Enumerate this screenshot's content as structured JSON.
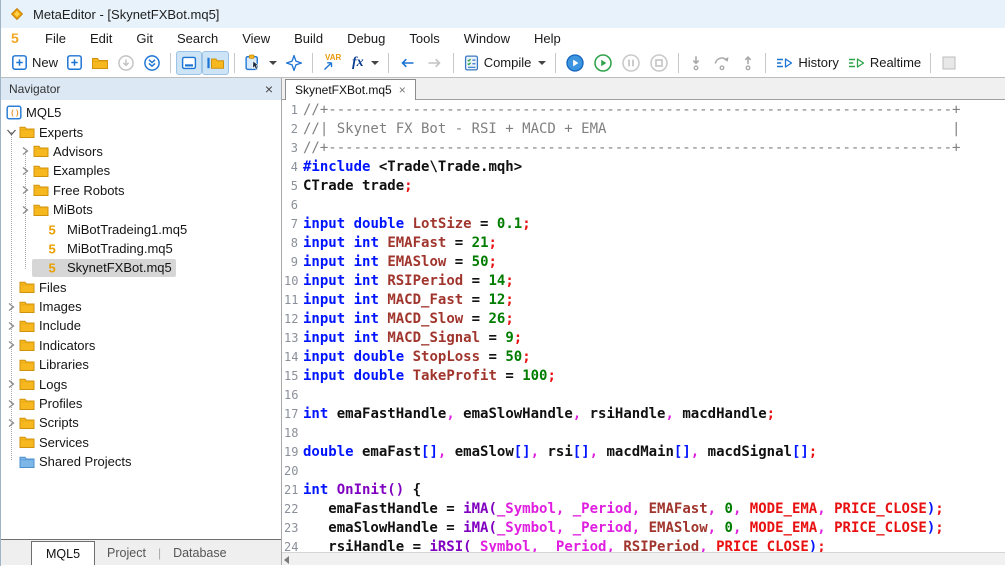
{
  "window": {
    "title": "MetaEditor - [SkynetFXBot.mq5]"
  },
  "menu": {
    "logo": "5",
    "items": [
      "File",
      "Edit",
      "Git",
      "Search",
      "View",
      "Build",
      "Debug",
      "Tools",
      "Window",
      "Help"
    ]
  },
  "toolbar": {
    "new": "New",
    "compile": "Compile",
    "history": "History",
    "realtime": "Realtime",
    "var_glyph": "VAR",
    "fx_glyph": "fx"
  },
  "navigator": {
    "title": "Navigator",
    "close_glyph": "×",
    "tree": [
      {
        "label": "MQL5",
        "icon": "mql5-root",
        "depth": 1,
        "exp": "none",
        "root": true
      },
      {
        "label": "Experts",
        "icon": "folder",
        "depth": 1,
        "exp": "open"
      },
      {
        "label": "Advisors",
        "icon": "folder",
        "depth": 2,
        "exp": "closed"
      },
      {
        "label": "Examples",
        "icon": "folder",
        "depth": 2,
        "exp": "closed"
      },
      {
        "label": "Free Robots",
        "icon": "folder",
        "depth": 2,
        "exp": "closed"
      },
      {
        "label": "MiBots",
        "icon": "folder",
        "depth": 2,
        "exp": "closed"
      },
      {
        "label": "MiBotTradeing1.mq5",
        "icon": "mq5",
        "depth": 2,
        "exp": "none",
        "file": true
      },
      {
        "label": "MiBotTrading.mq5",
        "icon": "mq5",
        "depth": 2,
        "exp": "none",
        "file": true
      },
      {
        "label": "SkynetFXBot.mq5",
        "icon": "mq5",
        "depth": 2,
        "exp": "none",
        "file": true,
        "selected": true
      },
      {
        "label": "Files",
        "icon": "folder",
        "depth": 1,
        "exp": "none"
      },
      {
        "label": "Images",
        "icon": "folder",
        "depth": 1,
        "exp": "closed"
      },
      {
        "label": "Include",
        "icon": "folder",
        "depth": 1,
        "exp": "closed"
      },
      {
        "label": "Indicators",
        "icon": "folder",
        "depth": 1,
        "exp": "closed"
      },
      {
        "label": "Libraries",
        "icon": "folder",
        "depth": 1,
        "exp": "none"
      },
      {
        "label": "Logs",
        "icon": "folder",
        "depth": 1,
        "exp": "closed"
      },
      {
        "label": "Profiles",
        "icon": "folder",
        "depth": 1,
        "exp": "closed"
      },
      {
        "label": "Scripts",
        "icon": "folder",
        "depth": 1,
        "exp": "closed"
      },
      {
        "label": "Services",
        "icon": "folder",
        "depth": 1,
        "exp": "none"
      },
      {
        "label": "Shared Projects",
        "icon": "folder-blue",
        "depth": 1,
        "exp": "none"
      }
    ],
    "bottom_tabs": [
      "MQL5",
      "Project",
      "Database"
    ],
    "active_bottom_tab": "MQL5",
    "separator_glyph": "|"
  },
  "editor": {
    "tab": {
      "label": "SkynetFXBot.mq5",
      "close_glyph": "×"
    },
    "lines": [
      {
        "num": "1",
        "tokens": [
          [
            "c",
            "//+--------------------------------------------------------------------------+"
          ]
        ]
      },
      {
        "num": "2",
        "tokens": [
          [
            "c",
            "//| Skynet FX Bot - RSI + MACD + EMA                                         |"
          ]
        ]
      },
      {
        "num": "3",
        "tokens": [
          [
            "c",
            "//+--------------------------------------------------------------------------+"
          ]
        ]
      },
      {
        "num": "4",
        "tokens": [
          [
            "k",
            "#include"
          ],
          [
            "p",
            " <Trade\\Trade.mqh>"
          ]
        ]
      },
      {
        "num": "5",
        "tokens": [
          [
            "p",
            "CTrade trade"
          ],
          [
            "r",
            ";"
          ]
        ]
      },
      {
        "num": "6",
        "tokens": []
      },
      {
        "num": "7",
        "tokens": [
          [
            "k",
            "input"
          ],
          [
            "p",
            " "
          ],
          [
            "k",
            "double"
          ],
          [
            "p",
            " "
          ],
          [
            "v",
            "LotSize"
          ],
          [
            "p",
            " = "
          ],
          [
            "n",
            "0.1"
          ],
          [
            "r",
            ";"
          ]
        ]
      },
      {
        "num": "8",
        "tokens": [
          [
            "k",
            "input"
          ],
          [
            "p",
            " "
          ],
          [
            "k",
            "int"
          ],
          [
            "p",
            " "
          ],
          [
            "v",
            "EMAFast"
          ],
          [
            "p",
            " = "
          ],
          [
            "n",
            "21"
          ],
          [
            "r",
            ";"
          ]
        ]
      },
      {
        "num": "9",
        "tokens": [
          [
            "k",
            "input"
          ],
          [
            "p",
            " "
          ],
          [
            "k",
            "int"
          ],
          [
            "p",
            " "
          ],
          [
            "v",
            "EMASlow"
          ],
          [
            "p",
            " = "
          ],
          [
            "n",
            "50"
          ],
          [
            "r",
            ";"
          ]
        ]
      },
      {
        "num": "10",
        "tokens": [
          [
            "k",
            "input"
          ],
          [
            "p",
            " "
          ],
          [
            "k",
            "int"
          ],
          [
            "p",
            " "
          ],
          [
            "v",
            "RSIPeriod"
          ],
          [
            "p",
            " = "
          ],
          [
            "n",
            "14"
          ],
          [
            "r",
            ";"
          ]
        ]
      },
      {
        "num": "11",
        "tokens": [
          [
            "k",
            "input"
          ],
          [
            "p",
            " "
          ],
          [
            "k",
            "int"
          ],
          [
            "p",
            " "
          ],
          [
            "v",
            "MACD_Fast"
          ],
          [
            "p",
            " = "
          ],
          [
            "n",
            "12"
          ],
          [
            "r",
            ";"
          ]
        ]
      },
      {
        "num": "12",
        "tokens": [
          [
            "k",
            "input"
          ],
          [
            "p",
            " "
          ],
          [
            "k",
            "int"
          ],
          [
            "p",
            " "
          ],
          [
            "v",
            "MACD_Slow"
          ],
          [
            "p",
            " = "
          ],
          [
            "n",
            "26"
          ],
          [
            "r",
            ";"
          ]
        ]
      },
      {
        "num": "13",
        "tokens": [
          [
            "k",
            "input"
          ],
          [
            "p",
            " "
          ],
          [
            "k",
            "int"
          ],
          [
            "p",
            " "
          ],
          [
            "v",
            "MACD_Signal"
          ],
          [
            "p",
            " = "
          ],
          [
            "n",
            "9"
          ],
          [
            "r",
            ";"
          ]
        ]
      },
      {
        "num": "14",
        "tokens": [
          [
            "k",
            "input"
          ],
          [
            "p",
            " "
          ],
          [
            "k",
            "double"
          ],
          [
            "p",
            " "
          ],
          [
            "v",
            "StopLoss"
          ],
          [
            "p",
            " = "
          ],
          [
            "n",
            "50"
          ],
          [
            "r",
            ";"
          ]
        ]
      },
      {
        "num": "15",
        "tokens": [
          [
            "k",
            "input"
          ],
          [
            "p",
            " "
          ],
          [
            "k",
            "double"
          ],
          [
            "p",
            " "
          ],
          [
            "v",
            "TakeProfit"
          ],
          [
            "p",
            " = "
          ],
          [
            "n",
            "100"
          ],
          [
            "r",
            ";"
          ]
        ]
      },
      {
        "num": "16",
        "tokens": []
      },
      {
        "num": "17",
        "tokens": [
          [
            "k",
            "int"
          ],
          [
            "p",
            " emaFastHandle"
          ],
          [
            "m",
            ","
          ],
          [
            "p",
            " emaSlowHandle"
          ],
          [
            "m",
            ","
          ],
          [
            "p",
            " rsiHandle"
          ],
          [
            "m",
            ","
          ],
          [
            "p",
            " macdHandle"
          ],
          [
            "r",
            ";"
          ]
        ]
      },
      {
        "num": "18",
        "tokens": []
      },
      {
        "num": "19",
        "tokens": [
          [
            "k",
            "double"
          ],
          [
            "p",
            " emaFast"
          ],
          [
            "k",
            "[]"
          ],
          [
            "m",
            ","
          ],
          [
            "p",
            " emaSlow"
          ],
          [
            "k",
            "[]"
          ],
          [
            "m",
            ","
          ],
          [
            "p",
            " rsi"
          ],
          [
            "k",
            "[]"
          ],
          [
            "m",
            ","
          ],
          [
            "p",
            " macdMain"
          ],
          [
            "k",
            "[]"
          ],
          [
            "m",
            ","
          ],
          [
            "p",
            " macdSignal"
          ],
          [
            "k",
            "[]"
          ],
          [
            "r",
            ";"
          ]
        ]
      },
      {
        "num": "20",
        "tokens": []
      },
      {
        "num": "21",
        "tokens": [
          [
            "k",
            "int"
          ],
          [
            "p",
            " "
          ],
          [
            "f",
            "OnInit()"
          ],
          [
            "p",
            " {"
          ]
        ]
      },
      {
        "num": "22",
        "tokens": [
          [
            "p",
            "   emaFastHandle = "
          ],
          [
            "f",
            "iMA("
          ],
          [
            "m",
            "_Symbol"
          ],
          [
            "m",
            ", "
          ],
          [
            "m",
            "_Period"
          ],
          [
            "m",
            ", "
          ],
          [
            "v",
            "EMAFast"
          ],
          [
            "m",
            ", "
          ],
          [
            "n",
            "0"
          ],
          [
            "m",
            ", "
          ],
          [
            "r",
            "MODE_EMA"
          ],
          [
            "m",
            ", "
          ],
          [
            "r",
            "PRICE_CLOSE"
          ],
          [
            "k",
            ")"
          ],
          [
            "r",
            ";"
          ]
        ]
      },
      {
        "num": "23",
        "tokens": [
          [
            "p",
            "   emaSlowHandle = "
          ],
          [
            "f",
            "iMA("
          ],
          [
            "m",
            "_Symbol"
          ],
          [
            "m",
            ", "
          ],
          [
            "m",
            "_Period"
          ],
          [
            "m",
            ", "
          ],
          [
            "v",
            "EMASlow"
          ],
          [
            "m",
            ", "
          ],
          [
            "n",
            "0"
          ],
          [
            "m",
            ", "
          ],
          [
            "r",
            "MODE_EMA"
          ],
          [
            "m",
            ", "
          ],
          [
            "r",
            "PRICE_CLOSE"
          ],
          [
            "k",
            ")"
          ],
          [
            "r",
            ";"
          ]
        ]
      },
      {
        "num": "24",
        "tokens": [
          [
            "p",
            "   rsiHandle = "
          ],
          [
            "f",
            "iRSI("
          ],
          [
            "m",
            "_Symbol"
          ],
          [
            "m",
            ", "
          ],
          [
            "m",
            "_Period"
          ],
          [
            "m",
            ", "
          ],
          [
            "v",
            "RSIPeriod"
          ],
          [
            "m",
            ", "
          ],
          [
            "r",
            "PRICE_CLOSE"
          ],
          [
            "k",
            ")"
          ],
          [
            "r",
            ";"
          ]
        ]
      }
    ]
  },
  "colors": {
    "accent_blue": "#1c74d4",
    "folder_yellow": "#f6b81e",
    "run_green": "#2fa34a",
    "keyword_blue": "#0014ff",
    "number_green": "#007d00",
    "constant_red": "#e81010",
    "magenta": "#e01ee0",
    "function_violet": "#8000c0",
    "comment_gray": "#808080",
    "identifier_maroon": "#a0352d",
    "titlebar_bg": "#e7f2fa",
    "selection_gray": "#d6d6d6"
  }
}
